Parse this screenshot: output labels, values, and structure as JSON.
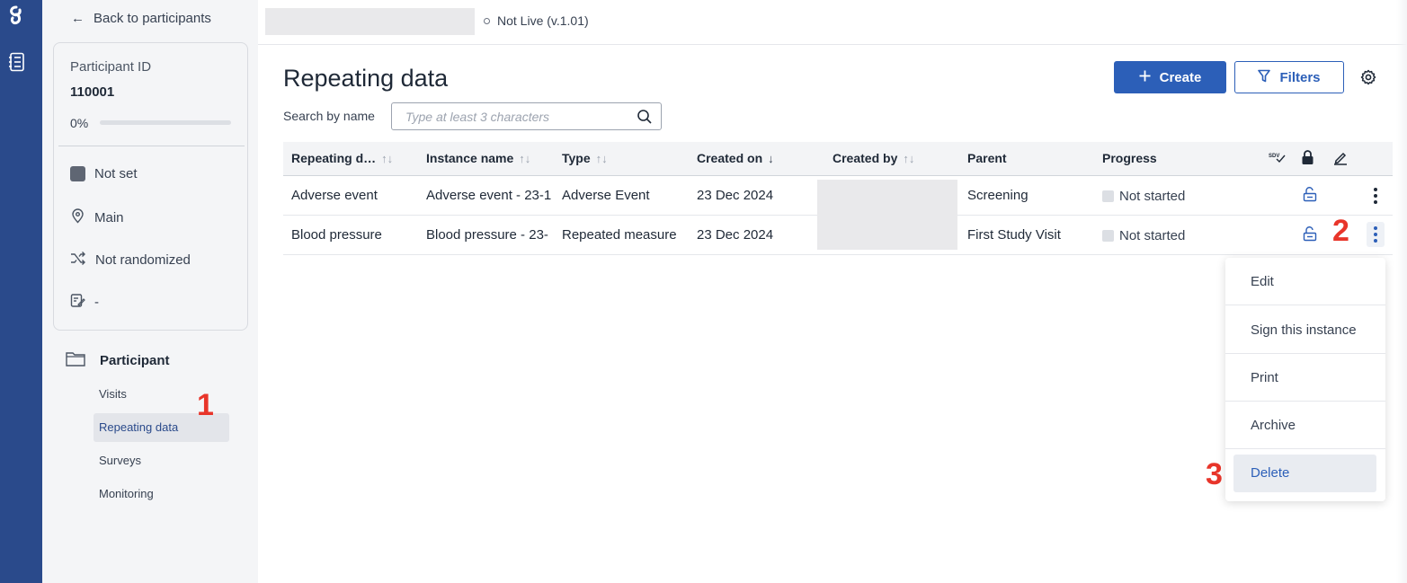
{
  "sidebar": {
    "back_label": "Back to participants",
    "participant_id_label": "Participant ID",
    "participant_id": "110001",
    "progress_text": "0%",
    "progress_value": 0,
    "status_label": "Not set",
    "site_label": "Main",
    "randomization_label": "Not randomized",
    "form_label": "-",
    "section_label": "Participant",
    "nav": [
      {
        "label": "Visits"
      },
      {
        "label": "Repeating data",
        "active": true
      },
      {
        "label": "Surveys"
      },
      {
        "label": "Monitoring"
      }
    ]
  },
  "topbar": {
    "status_text": "Not Live (v.1.01)"
  },
  "main": {
    "title": "Repeating data",
    "create_label": "Create",
    "filters_label": "Filters",
    "search_label": "Search by name",
    "search_placeholder": "Type at least 3 characters"
  },
  "table": {
    "columns": [
      {
        "label": "Repeating d…",
        "sort": "↑↓"
      },
      {
        "label": "Instance name",
        "sort": "↑↓"
      },
      {
        "label": "Type",
        "sort": "↑↓"
      },
      {
        "label": "Created on",
        "sort": "↓"
      },
      {
        "label": "Created by",
        "sort": "↑↓"
      },
      {
        "label": "Parent"
      },
      {
        "label": "Progress"
      },
      {
        "label": "SDV"
      }
    ],
    "rows": [
      {
        "name": "Adverse event",
        "instance": "Adverse event - 23-1",
        "type": "Adverse Event",
        "created_on": "23 Dec 2024",
        "parent": "Screening",
        "progress": "Not started"
      },
      {
        "name": "Blood pressure",
        "instance": "Blood pressure - 23-",
        "type": "Repeated measure",
        "created_on": "23 Dec 2024",
        "parent": "First Study Visit",
        "progress": "Not started"
      }
    ]
  },
  "menu": {
    "items": [
      "Edit",
      "Sign this instance",
      "Print",
      "Archive",
      "Delete"
    ]
  },
  "markers": [
    "1",
    "2",
    "3"
  ],
  "colors": {
    "rail": "#2a4a8b",
    "primary": "#2c5fb8",
    "marker": "#e8352a"
  }
}
